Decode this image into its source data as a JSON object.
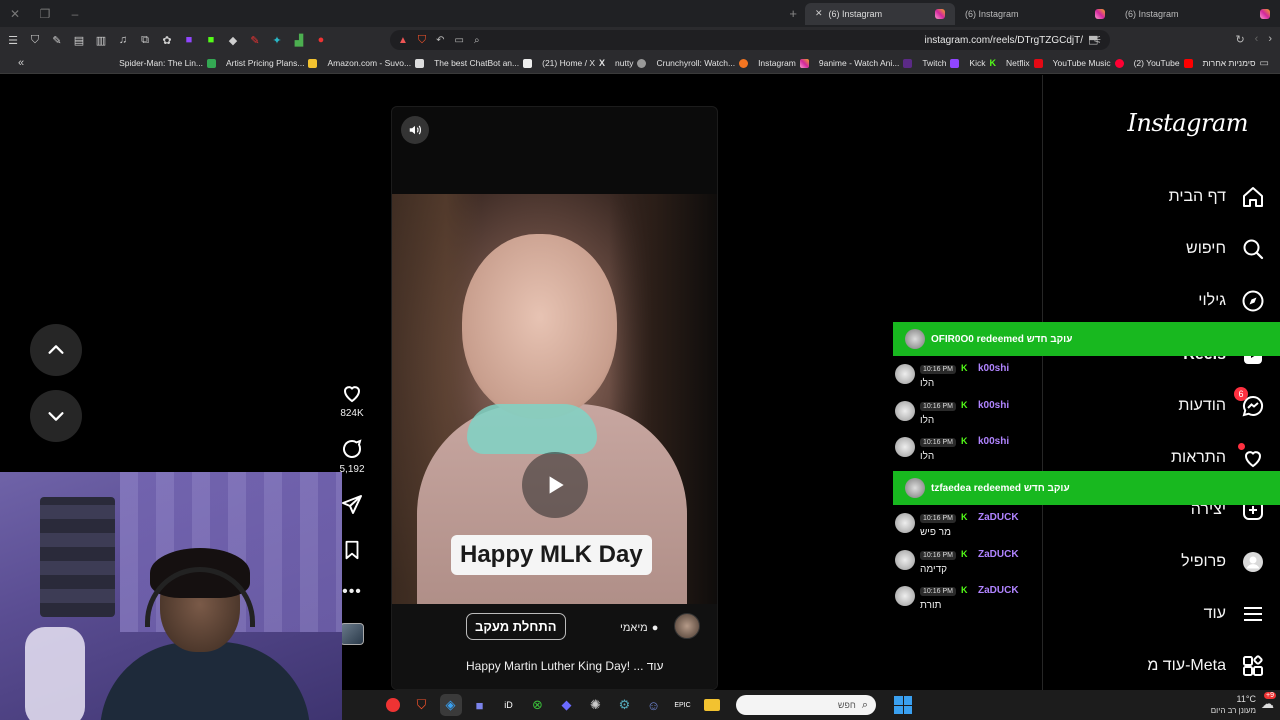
{
  "browser": {
    "tabs": [
      {
        "label": "(6) Instagram",
        "active": true
      },
      {
        "label": "(6) Instagram",
        "active": false
      },
      {
        "label": "(6) Instagram",
        "active": false
      }
    ],
    "url": "instagram.com/reels/DTrgTZGCdjT/",
    "bookmarks": [
      {
        "label": "Spider-Man: The Lin...",
        "color": "#ddd"
      },
      {
        "label": "Artist Pricing Plans...",
        "color": "#f2c230"
      },
      {
        "label": "Amazon.com - Suvo...",
        "color": "#222"
      },
      {
        "label": "The best ChatBot an...",
        "color": "#eee"
      },
      {
        "label": "(21) Home / X",
        "color": "#111"
      },
      {
        "label": "nutty",
        "color": "#777"
      },
      {
        "label": "Crunchyroll: Watch...",
        "color": "#f47521"
      },
      {
        "label": "Instagram",
        "color": "#d0279d"
      },
      {
        "label": "9anime - Watch Ani...",
        "color": "#5b2a86"
      },
      {
        "label": "Twitch",
        "color": "#9146ff"
      },
      {
        "label": "Kick",
        "color": "#53fc18"
      },
      {
        "label": "Netflix",
        "color": "#e50914"
      },
      {
        "label": "YouTube Music",
        "color": "#ff0033"
      },
      {
        "label": "(2) YouTube",
        "color": "#ff0000"
      },
      {
        "label": "סימניות אחרות",
        "color": "#bbb"
      }
    ]
  },
  "instagram": {
    "logo": "Instagram",
    "nav": [
      {
        "label": "דף הבית",
        "icon": "home-icon"
      },
      {
        "label": "חיפוש",
        "icon": "search-icon"
      },
      {
        "label": "גילוי",
        "icon": "compass-icon"
      },
      {
        "label": "Reels",
        "icon": "reels-icon"
      },
      {
        "label": "הודעות",
        "icon": "messenger-icon",
        "badge": "6"
      },
      {
        "label": "התראות",
        "icon": "heart-icon"
      },
      {
        "label": "יצירה",
        "icon": "plus-icon"
      },
      {
        "label": "פרופיל",
        "icon": "profile-icon"
      },
      {
        "label": "עוד",
        "icon": "menu-icon"
      },
      {
        "label": "עוד מ-Meta",
        "icon": "meta-grid-icon"
      }
    ],
    "reel": {
      "sticker_text": "Happy MLK Day",
      "follow_label": "התחלת מעקב",
      "location": "מיאמי",
      "description": "Happy Martin Luther King Day! ... עוד"
    },
    "actions": {
      "likes": "824K",
      "comments": "5,192"
    }
  },
  "chat": {
    "redeems": [
      {
        "text": "OFIR0O0 redeemed עוקב חדש"
      },
      {
        "text": "tzfaedea redeemed עוקב חדש"
      }
    ],
    "messages": [
      {
        "time": "10:16 PM",
        "user": "k00shi",
        "color": "#b084ff",
        "text": "הלו"
      },
      {
        "time": "10:16 PM",
        "user": "k00shi",
        "color": "#b084ff",
        "text": "הלו"
      },
      {
        "time": "10:16 PM",
        "user": "k00shi",
        "color": "#b084ff",
        "text": "הלו"
      },
      {
        "time": "10:16 PM",
        "user": "ZaDUCK",
        "color": "#b084ff",
        "text": "מר פיש"
      },
      {
        "time": "10:16 PM",
        "user": "ZaDUCK",
        "color": "#b084ff",
        "text": "קדימה"
      },
      {
        "time": "10:16 PM",
        "user": "ZaDUCK",
        "color": "#b084ff",
        "text": "תורת"
      }
    ]
  },
  "taskbar": {
    "search_placeholder": "חפש",
    "temperature": "11°C",
    "weather": "מעונן רב היום",
    "notification_count": "+9"
  }
}
